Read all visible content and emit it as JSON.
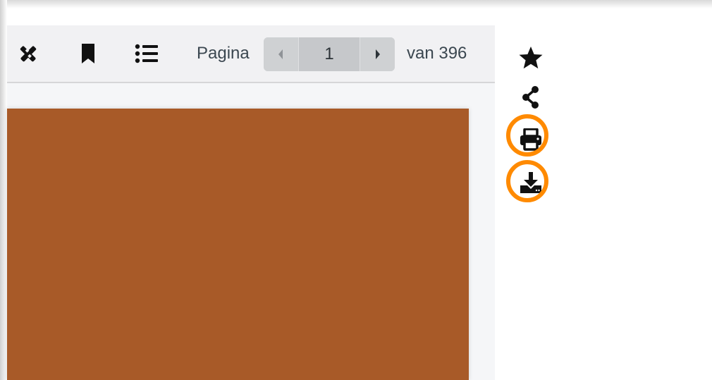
{
  "toolbar": {
    "icons": [
      "annotate-icon",
      "bookmark-icon",
      "table-of-contents-icon"
    ],
    "page_label": "Pagina",
    "current_page": "1",
    "total_pages_label": "van 396"
  },
  "side_actions": {
    "icons": [
      "favorite-star-icon",
      "share-icon",
      "print-icon",
      "download-icon"
    ],
    "highlighted": [
      "print-icon",
      "download-icon"
    ]
  },
  "colors": {
    "document_page": "#a85a28",
    "highlight": "#ff8a00",
    "toolbar_bg": "#f1f1f3",
    "icon": "#111111"
  }
}
